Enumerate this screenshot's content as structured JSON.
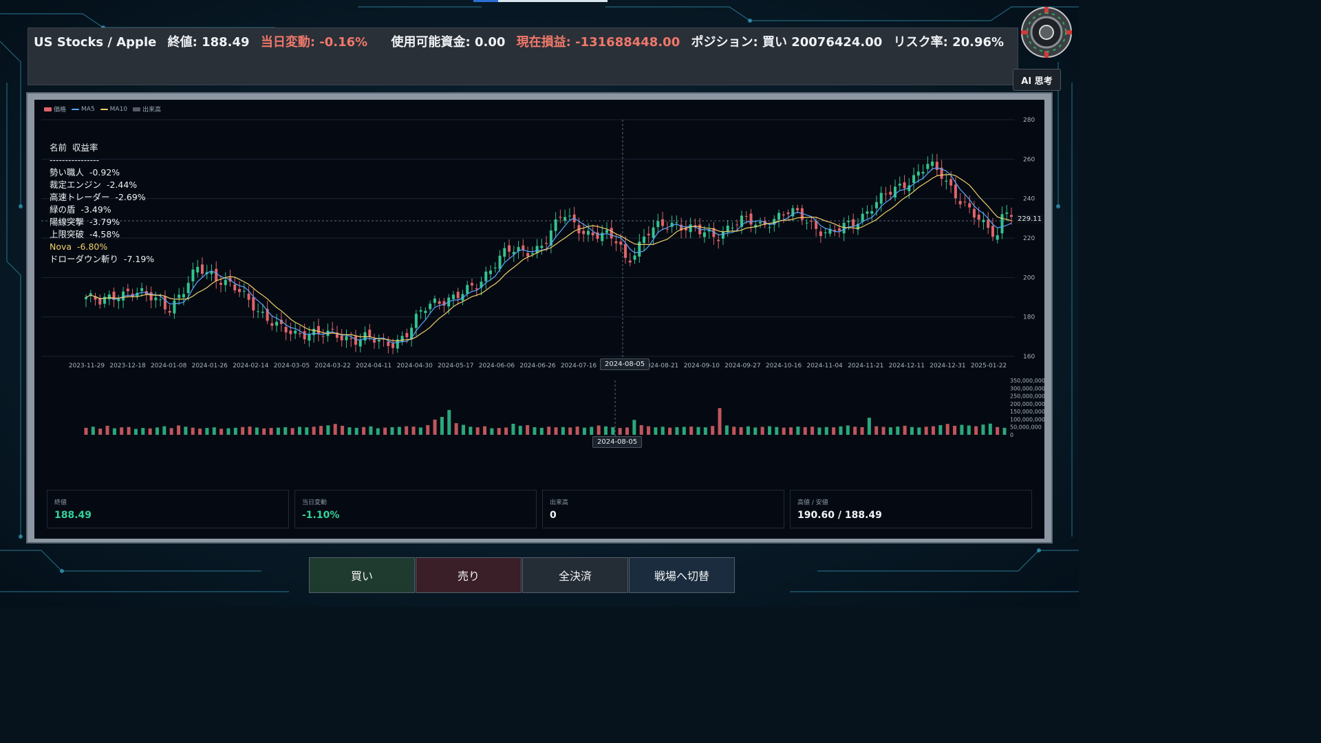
{
  "header": {
    "market": "US Stocks / Apple",
    "close": "終値: 188.49",
    "day_change": "当日変動: -0.16%",
    "funds": "使用可能資金: 0.00",
    "pnl": "現在損益: -131688448.00",
    "position": "ポジション: 買い 20076424.00",
    "risk": "リスク率: 20.96%"
  },
  "ai_button": "AI 思考",
  "legend": [
    "価格",
    "MA5",
    "MA10",
    "出来高"
  ],
  "ranking": {
    "header": "名前  収益率",
    "divider": "----------------",
    "rows": [
      {
        "name": "勢い職人",
        "ret": "-0.92%"
      },
      {
        "name": "裁定エンジン",
        "ret": "-2.44%"
      },
      {
        "name": "高速トレーダー",
        "ret": "-2.69%"
      },
      {
        "name": "緑の盾",
        "ret": "-3.49%"
      },
      {
        "name": "陽線突撃",
        "ret": "-3.79%"
      },
      {
        "name": "上限突破",
        "ret": "-4.58%"
      },
      {
        "name": "Nova",
        "ret": "-6.80%"
      },
      {
        "name": "ドローダウン斬り",
        "ret": "-7.19%"
      }
    ]
  },
  "crosshair_date": "2024-08-05",
  "crosshair_price": "229.11",
  "stats": [
    {
      "label": "終値",
      "value": "188.49"
    },
    {
      "label": "当日変動",
      "value": "-1.10%"
    },
    {
      "label": "出来高",
      "value": "0"
    },
    {
      "label": "高値 / 安値",
      "value": "190.60 / 188.49"
    }
  ],
  "buttons": {
    "buy": "買い",
    "sell": "売り",
    "close_all": "全決済",
    "switch": "戦場へ切替"
  },
  "colors": {
    "up": "#34c38f",
    "down": "#e0646a",
    "ma5": "#5aa7ff",
    "ma10": "#f2d06b",
    "volume": "#555a68"
  },
  "chart_data": {
    "type": "candlestick",
    "x_ticks": [
      "2023-11-29",
      "2023-12-18",
      "2024-01-08",
      "2024-01-26",
      "2024-02-14",
      "2024-03-05",
      "2024-03-22",
      "2024-04-11",
      "2024-04-30",
      "2024-05-17",
      "2024-06-06",
      "2024-06-26",
      "2024-07-16",
      "2024-08-05",
      "2024-08-21",
      "2024-09-10",
      "2024-09-27",
      "2024-10-16",
      "2024-11-04",
      "2024-11-21",
      "2024-12-11",
      "2024-12-31",
      "2025-01-22"
    ],
    "y_ticks": [
      160,
      180,
      200,
      220,
      240,
      260,
      280
    ],
    "ylim": [
      160,
      280
    ],
    "vol_ticks": [
      "350,000,000",
      "300,000,000",
      "250,000,000",
      "200,000,000",
      "150,000,000",
      "100,000,000",
      "50,000,000",
      "0"
    ],
    "vol_lim": [
      0,
      350000000
    ],
    "close_series": [
      [
        0,
        190
      ],
      [
        2,
        187
      ],
      [
        4,
        191
      ],
      [
        6,
        193
      ],
      [
        8,
        191
      ],
      [
        10,
        189
      ],
      [
        12,
        185
      ],
      [
        14,
        193
      ],
      [
        16,
        205
      ],
      [
        18,
        202
      ],
      [
        20,
        197
      ],
      [
        22,
        192
      ],
      [
        24,
        186
      ],
      [
        26,
        179
      ],
      [
        28,
        173
      ],
      [
        30,
        171
      ],
      [
        32,
        173
      ],
      [
        34,
        171
      ],
      [
        36,
        170
      ],
      [
        38,
        169
      ],
      [
        40,
        170
      ],
      [
        42,
        166
      ],
      [
        44,
        167
      ],
      [
        46,
        173
      ],
      [
        48,
        183
      ],
      [
        50,
        188
      ],
      [
        52,
        190
      ],
      [
        54,
        192
      ],
      [
        56,
        196
      ],
      [
        58,
        207
      ],
      [
        60,
        214
      ],
      [
        62,
        212
      ],
      [
        64,
        214
      ],
      [
        66,
        221
      ],
      [
        68,
        232
      ],
      [
        70,
        226
      ],
      [
        72,
        222
      ],
      [
        74,
        221
      ],
      [
        76,
        218
      ],
      [
        77,
        209
      ],
      [
        78,
        212
      ],
      [
        80,
        222
      ],
      [
        82,
        226
      ],
      [
        84,
        228
      ],
      [
        86,
        225
      ],
      [
        88,
        222
      ],
      [
        90,
        221
      ],
      [
        92,
        227
      ],
      [
        94,
        229
      ],
      [
        96,
        226
      ],
      [
        98,
        230
      ],
      [
        100,
        233
      ],
      [
        102,
        231
      ],
      [
        104,
        226
      ],
      [
        106,
        222
      ],
      [
        108,
        225
      ],
      [
        110,
        229
      ],
      [
        112,
        236
      ],
      [
        114,
        241
      ],
      [
        116,
        246
      ],
      [
        118,
        251
      ],
      [
        120,
        257
      ],
      [
        122,
        252
      ],
      [
        124,
        243
      ],
      [
        126,
        234
      ],
      [
        128,
        226
      ],
      [
        130,
        222
      ],
      [
        131,
        236
      ],
      [
        132,
        233
      ]
    ],
    "volumes": [
      45,
      52,
      40,
      58,
      42,
      48,
      50,
      38,
      44,
      41,
      47,
      55,
      43,
      60,
      52,
      46,
      40,
      44,
      48,
      39,
      42,
      45,
      50,
      53,
      47,
      41,
      44,
      46,
      49,
      43,
      51,
      48,
      52,
      57,
      61,
      70,
      58,
      48,
      45,
      50,
      54,
      42,
      46,
      49,
      51,
      55,
      53,
      47,
      62,
      98,
      115,
      160,
      75,
      64,
      52,
      48,
      55,
      42,
      44,
      47,
      71,
      58,
      62,
      49,
      45,
      52,
      48,
      50,
      47,
      53,
      46,
      51,
      60,
      54,
      49,
      44,
      47,
      96,
      62,
      55,
      48,
      52,
      46,
      49,
      51,
      53,
      50,
      48,
      57,
      172,
      60,
      52,
      49,
      54,
      47,
      51,
      55,
      50,
      46,
      48,
      53,
      49,
      52,
      47,
      50,
      48,
      54,
      60,
      52,
      49,
      110,
      55,
      51,
      48,
      53,
      58,
      50,
      47,
      52,
      55,
      62,
      70,
      58,
      64,
      60,
      55,
      66,
      72,
      50,
      45
    ]
  }
}
